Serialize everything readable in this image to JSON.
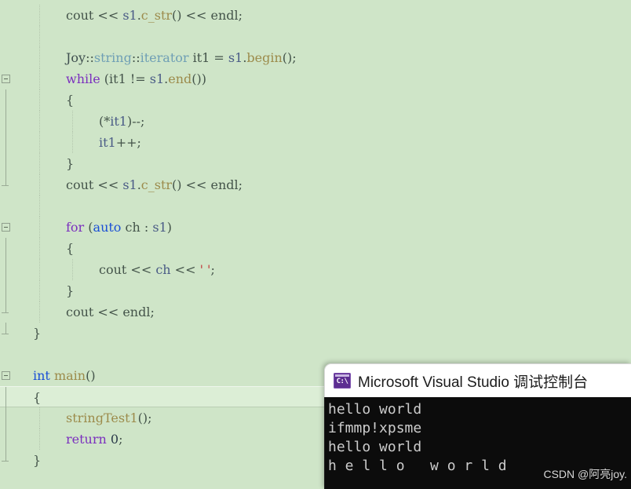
{
  "editor": {
    "background_color": "#cfe5c8",
    "current_line_index": 18,
    "lines": [
      {
        "indent": 1,
        "fold": "none",
        "tokens": [
          {
            "t": "cout",
            "c": "plain"
          },
          {
            "t": " << ",
            "c": "plain"
          },
          {
            "t": "s1",
            "c": "var"
          },
          {
            "t": ".",
            "c": "plain"
          },
          {
            "t": "c_str",
            "c": "fn"
          },
          {
            "t": "() << ",
            "c": "plain"
          },
          {
            "t": "endl",
            "c": "plain"
          },
          {
            "t": ";",
            "c": "plain"
          }
        ]
      },
      {
        "indent": 1,
        "fold": "none",
        "tokens": []
      },
      {
        "indent": 1,
        "fold": "none",
        "tokens": [
          {
            "t": "Joy",
            "c": "ns"
          },
          {
            "t": "::",
            "c": "plain"
          },
          {
            "t": "string",
            "c": "cls"
          },
          {
            "t": "::",
            "c": "plain"
          },
          {
            "t": "iterator",
            "c": "cls"
          },
          {
            "t": " it1 = ",
            "c": "plain"
          },
          {
            "t": "s1",
            "c": "var"
          },
          {
            "t": ".",
            "c": "plain"
          },
          {
            "t": "begin",
            "c": "fn"
          },
          {
            "t": "();",
            "c": "plain"
          }
        ]
      },
      {
        "indent": 1,
        "fold": "box",
        "tokens": [
          {
            "t": "while",
            "c": "kw"
          },
          {
            "t": " (it1 != ",
            "c": "plain"
          },
          {
            "t": "s1",
            "c": "var"
          },
          {
            "t": ".",
            "c": "plain"
          },
          {
            "t": "end",
            "c": "fn"
          },
          {
            "t": "())",
            "c": "plain"
          }
        ]
      },
      {
        "indent": 1,
        "fold": "line",
        "tokens": [
          {
            "t": "{",
            "c": "plain"
          }
        ]
      },
      {
        "indent": 2,
        "fold": "line",
        "tokens": [
          {
            "t": "(*",
            "c": "plain"
          },
          {
            "t": "it1",
            "c": "var"
          },
          {
            "t": ")--;",
            "c": "plain"
          }
        ]
      },
      {
        "indent": 2,
        "fold": "line",
        "tokens": [
          {
            "t": "it1",
            "c": "var"
          },
          {
            "t": "++;",
            "c": "plain"
          }
        ]
      },
      {
        "indent": 1,
        "fold": "line",
        "tokens": [
          {
            "t": "}",
            "c": "plain"
          }
        ]
      },
      {
        "indent": 1,
        "fold": "dash",
        "tokens": [
          {
            "t": "cout",
            "c": "plain"
          },
          {
            "t": " << ",
            "c": "plain"
          },
          {
            "t": "s1",
            "c": "var"
          },
          {
            "t": ".",
            "c": "plain"
          },
          {
            "t": "c_str",
            "c": "fn"
          },
          {
            "t": "() << ",
            "c": "plain"
          },
          {
            "t": "endl",
            "c": "plain"
          },
          {
            "t": ";",
            "c": "plain"
          }
        ]
      },
      {
        "indent": 1,
        "fold": "none",
        "tokens": []
      },
      {
        "indent": 1,
        "fold": "box",
        "tokens": [
          {
            "t": "for",
            "c": "kw"
          },
          {
            "t": " (",
            "c": "plain"
          },
          {
            "t": "auto",
            "c": "type"
          },
          {
            "t": " ch : ",
            "c": "plain"
          },
          {
            "t": "s1",
            "c": "var"
          },
          {
            "t": ")",
            "c": "plain"
          }
        ]
      },
      {
        "indent": 1,
        "fold": "line",
        "tokens": [
          {
            "t": "{",
            "c": "plain"
          }
        ]
      },
      {
        "indent": 2,
        "fold": "line",
        "tokens": [
          {
            "t": "cout",
            "c": "plain"
          },
          {
            "t": " << ",
            "c": "plain"
          },
          {
            "t": "ch",
            "c": "var"
          },
          {
            "t": " << ",
            "c": "plain"
          },
          {
            "t": "' '",
            "c": "str"
          },
          {
            "t": ";",
            "c": "plain"
          }
        ]
      },
      {
        "indent": 1,
        "fold": "line",
        "tokens": [
          {
            "t": "}",
            "c": "plain"
          }
        ]
      },
      {
        "indent": 1,
        "fold": "dash",
        "tokens": [
          {
            "t": "cout",
            "c": "plain"
          },
          {
            "t": " << ",
            "c": "plain"
          },
          {
            "t": "endl",
            "c": "plain"
          },
          {
            "t": ";",
            "c": "plain"
          }
        ]
      },
      {
        "indent": 0,
        "fold": "dash",
        "tokens": [
          {
            "t": "}",
            "c": "plain"
          }
        ]
      },
      {
        "indent": 0,
        "fold": "none",
        "tokens": []
      },
      {
        "indent": 0,
        "fold": "box",
        "tokens": [
          {
            "t": "int",
            "c": "type"
          },
          {
            "t": " ",
            "c": "plain"
          },
          {
            "t": "main",
            "c": "fn"
          },
          {
            "t": "()",
            "c": "plain"
          }
        ]
      },
      {
        "indent": 0,
        "fold": "line",
        "tokens": [
          {
            "t": "{",
            "c": "plain"
          }
        ]
      },
      {
        "indent": 1,
        "fold": "line",
        "tokens": [
          {
            "t": "stringTest1",
            "c": "fn"
          },
          {
            "t": "();",
            "c": "plain"
          }
        ]
      },
      {
        "indent": 1,
        "fold": "line",
        "tokens": [
          {
            "t": "return",
            "c": "kw"
          },
          {
            "t": " ",
            "c": "plain"
          },
          {
            "t": "0",
            "c": "num"
          },
          {
            "t": ";",
            "c": "plain"
          }
        ]
      },
      {
        "indent": 0,
        "fold": "dash",
        "tokens": [
          {
            "t": "}",
            "c": "plain"
          }
        ]
      }
    ]
  },
  "console": {
    "title": "Microsoft Visual Studio 调试控制台",
    "icon": "console-cmd-icon",
    "icon_label": "C:\\",
    "background_color": "#0c0c0c",
    "text_color": "#cccccc",
    "output_lines": [
      "hello world",
      "ifmmp!xpsme",
      "hello world",
      "h e l l o   w o r l d "
    ],
    "watermark": "CSDN @阿亮joy."
  }
}
